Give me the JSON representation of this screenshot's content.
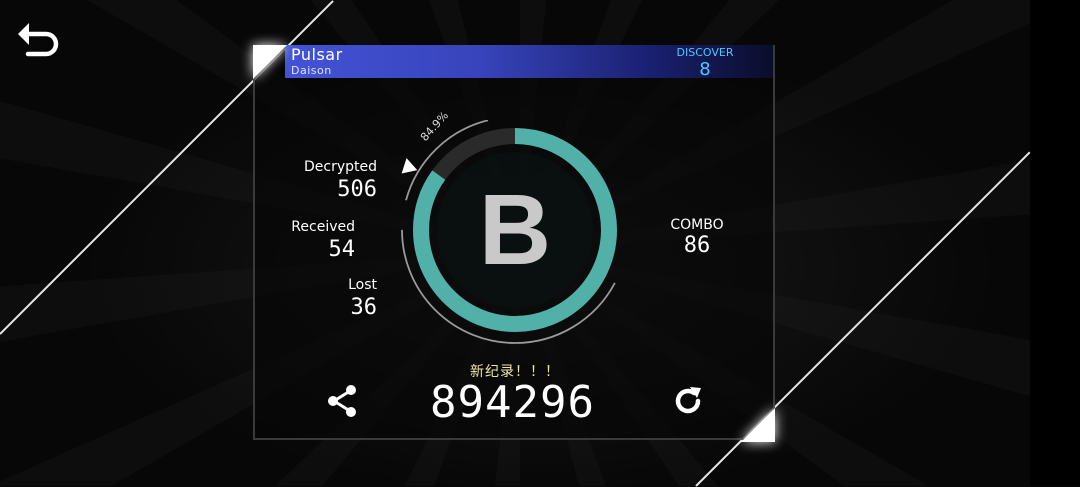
{
  "song": {
    "title": "Pulsar",
    "artist": "Daison"
  },
  "discover": {
    "label": "DISCOVER",
    "value": "8"
  },
  "stats": {
    "decrypted": {
      "label": "Decrypted",
      "value": "506"
    },
    "received": {
      "label": "Received",
      "value": "54"
    },
    "lost": {
      "label": "Lost",
      "value": "36"
    }
  },
  "combo": {
    "label": "COMBO",
    "value": "86"
  },
  "result": {
    "grade": "B",
    "accuracy": "84.9%",
    "accuracy_fraction": 0.849
  },
  "new_record_text": "新纪录！！！",
  "score": "894296",
  "icons": {
    "back": "back-arrow-icon",
    "share": "share-icon",
    "retry": "retry-icon"
  },
  "colors": {
    "header": "#4453d6",
    "discover": "#4fc7ff",
    "ring": "#58c9c0",
    "new_record": "#ece7a2"
  }
}
